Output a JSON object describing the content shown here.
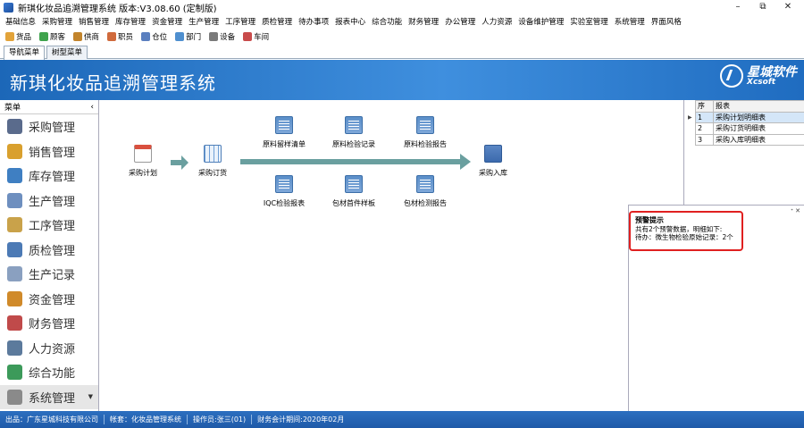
{
  "window": {
    "title": "新琪化妆品追溯管理系统 版本:V3.08.60 (定制版)",
    "controls": [
      "–",
      "⧉",
      "✕"
    ]
  },
  "menu": [
    "基础信息",
    "采购管理",
    "销售管理",
    "库存管理",
    "资金管理",
    "生产管理",
    "工序管理",
    "质检管理",
    "待办事项",
    "报表中心",
    "综合功能",
    "财务管理",
    "办公管理",
    "人力资源",
    "设备维护管理",
    "实验室管理",
    "系统管理",
    "界面风格"
  ],
  "toolbar": [
    {
      "label": "货品",
      "color": "#e2a33a"
    },
    {
      "label": "顾客",
      "color": "#3fa34d"
    },
    {
      "label": "供商",
      "color": "#c2842c"
    },
    {
      "label": "职员",
      "color": "#d06a3c"
    },
    {
      "label": "仓位",
      "color": "#5a7fbf"
    },
    {
      "label": "部门",
      "color": "#4f8fcf"
    },
    {
      "label": "设备",
      "color": "#7a7a7a"
    },
    {
      "label": "车间",
      "color": "#c84b4b"
    }
  ],
  "tabs": [
    "导航菜单",
    "树型菜单"
  ],
  "banner": {
    "title": "新琪化妆品追溯管理系统",
    "logo_cn": "星城软件",
    "logo_en": "Xcsoft"
  },
  "sidebar": {
    "header": "菜单",
    "collapse_glyph": "‹",
    "items": [
      {
        "label": "采购管理",
        "color": "#5a6b8c"
      },
      {
        "label": "销售管理",
        "color": "#d9a02e"
      },
      {
        "label": "库存管理",
        "color": "#3f7fc2"
      },
      {
        "label": "生产管理",
        "color": "#6e8fbf"
      },
      {
        "label": "工序管理",
        "color": "#c9a24a"
      },
      {
        "label": "质检管理",
        "color": "#4c7ab5"
      },
      {
        "label": "生产记录",
        "color": "#8aa0c0"
      },
      {
        "label": "资金管理",
        "color": "#d08a2a"
      },
      {
        "label": "财务管理",
        "color": "#c04a4a"
      },
      {
        "label": "人力资源",
        "color": "#5c7a9c"
      },
      {
        "label": "综合功能",
        "color": "#3c9a5a"
      },
      {
        "label": "系统管理",
        "color": "#8a8a8a"
      }
    ]
  },
  "flow": {
    "nodes": {
      "plan": "采购计划",
      "order": "采购订货",
      "inbound": "采购入库",
      "raw_sample": "原料留样清单",
      "raw_inspect": "原料检验记录",
      "raw_report": "原料检验报告",
      "iqc": "IQC检验报表",
      "pack_first": "包材首件样板",
      "pack_report": "包材检测报告"
    }
  },
  "reports": {
    "headers": [
      "序",
      "报表"
    ],
    "rows": [
      {
        "no": "1",
        "name": "采购计划明细表"
      },
      {
        "no": "2",
        "name": "采购订货明细表"
      },
      {
        "no": "3",
        "name": "采购入库明细表"
      }
    ]
  },
  "alert": {
    "title": "预警提示",
    "line1": "共有2个预警数据，明细如下:",
    "line2": "待办：微生物检验原始记录：2个",
    "controls": "ᐩ ✕"
  },
  "status": [
    "出品：广东星城科技有限公司",
    "帐套：化妆品管理系统",
    "操作员:张三(01)",
    "财务会计期间:2020年02月"
  ]
}
